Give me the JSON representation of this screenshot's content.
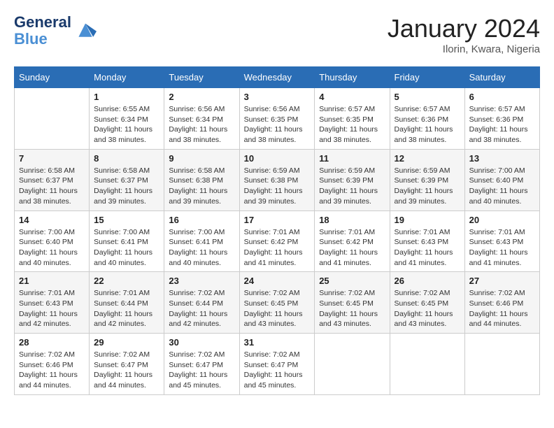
{
  "header": {
    "logo_line1": "General",
    "logo_line2": "Blue",
    "month_title": "January 2024",
    "location": "Ilorin, Kwara, Nigeria"
  },
  "days_of_week": [
    "Sunday",
    "Monday",
    "Tuesday",
    "Wednesday",
    "Thursday",
    "Friday",
    "Saturday"
  ],
  "weeks": [
    [
      {
        "day": "",
        "empty": true
      },
      {
        "day": "1",
        "sunrise": "6:55 AM",
        "sunset": "6:34 PM",
        "daylight": "11 hours and 38 minutes."
      },
      {
        "day": "2",
        "sunrise": "6:56 AM",
        "sunset": "6:34 PM",
        "daylight": "11 hours and 38 minutes."
      },
      {
        "day": "3",
        "sunrise": "6:56 AM",
        "sunset": "6:35 PM",
        "daylight": "11 hours and 38 minutes."
      },
      {
        "day": "4",
        "sunrise": "6:57 AM",
        "sunset": "6:35 PM",
        "daylight": "11 hours and 38 minutes."
      },
      {
        "day": "5",
        "sunrise": "6:57 AM",
        "sunset": "6:36 PM",
        "daylight": "11 hours and 38 minutes."
      },
      {
        "day": "6",
        "sunrise": "6:57 AM",
        "sunset": "6:36 PM",
        "daylight": "11 hours and 38 minutes."
      }
    ],
    [
      {
        "day": "7",
        "sunrise": "6:58 AM",
        "sunset": "6:37 PM",
        "daylight": "11 hours and 38 minutes."
      },
      {
        "day": "8",
        "sunrise": "6:58 AM",
        "sunset": "6:37 PM",
        "daylight": "11 hours and 39 minutes."
      },
      {
        "day": "9",
        "sunrise": "6:58 AM",
        "sunset": "6:38 PM",
        "daylight": "11 hours and 39 minutes."
      },
      {
        "day": "10",
        "sunrise": "6:59 AM",
        "sunset": "6:38 PM",
        "daylight": "11 hours and 39 minutes."
      },
      {
        "day": "11",
        "sunrise": "6:59 AM",
        "sunset": "6:39 PM",
        "daylight": "11 hours and 39 minutes."
      },
      {
        "day": "12",
        "sunrise": "6:59 AM",
        "sunset": "6:39 PM",
        "daylight": "11 hours and 39 minutes."
      },
      {
        "day": "13",
        "sunrise": "7:00 AM",
        "sunset": "6:40 PM",
        "daylight": "11 hours and 40 minutes."
      }
    ],
    [
      {
        "day": "14",
        "sunrise": "7:00 AM",
        "sunset": "6:40 PM",
        "daylight": "11 hours and 40 minutes."
      },
      {
        "day": "15",
        "sunrise": "7:00 AM",
        "sunset": "6:41 PM",
        "daylight": "11 hours and 40 minutes."
      },
      {
        "day": "16",
        "sunrise": "7:00 AM",
        "sunset": "6:41 PM",
        "daylight": "11 hours and 40 minutes."
      },
      {
        "day": "17",
        "sunrise": "7:01 AM",
        "sunset": "6:42 PM",
        "daylight": "11 hours and 41 minutes."
      },
      {
        "day": "18",
        "sunrise": "7:01 AM",
        "sunset": "6:42 PM",
        "daylight": "11 hours and 41 minutes."
      },
      {
        "day": "19",
        "sunrise": "7:01 AM",
        "sunset": "6:43 PM",
        "daylight": "11 hours and 41 minutes."
      },
      {
        "day": "20",
        "sunrise": "7:01 AM",
        "sunset": "6:43 PM",
        "daylight": "11 hours and 41 minutes."
      }
    ],
    [
      {
        "day": "21",
        "sunrise": "7:01 AM",
        "sunset": "6:43 PM",
        "daylight": "11 hours and 42 minutes."
      },
      {
        "day": "22",
        "sunrise": "7:01 AM",
        "sunset": "6:44 PM",
        "daylight": "11 hours and 42 minutes."
      },
      {
        "day": "23",
        "sunrise": "7:02 AM",
        "sunset": "6:44 PM",
        "daylight": "11 hours and 42 minutes."
      },
      {
        "day": "24",
        "sunrise": "7:02 AM",
        "sunset": "6:45 PM",
        "daylight": "11 hours and 43 minutes."
      },
      {
        "day": "25",
        "sunrise": "7:02 AM",
        "sunset": "6:45 PM",
        "daylight": "11 hours and 43 minutes."
      },
      {
        "day": "26",
        "sunrise": "7:02 AM",
        "sunset": "6:45 PM",
        "daylight": "11 hours and 43 minutes."
      },
      {
        "day": "27",
        "sunrise": "7:02 AM",
        "sunset": "6:46 PM",
        "daylight": "11 hours and 44 minutes."
      }
    ],
    [
      {
        "day": "28",
        "sunrise": "7:02 AM",
        "sunset": "6:46 PM",
        "daylight": "11 hours and 44 minutes."
      },
      {
        "day": "29",
        "sunrise": "7:02 AM",
        "sunset": "6:47 PM",
        "daylight": "11 hours and 44 minutes."
      },
      {
        "day": "30",
        "sunrise": "7:02 AM",
        "sunset": "6:47 PM",
        "daylight": "11 hours and 45 minutes."
      },
      {
        "day": "31",
        "sunrise": "7:02 AM",
        "sunset": "6:47 PM",
        "daylight": "11 hours and 45 minutes."
      },
      {
        "day": "",
        "empty": true
      },
      {
        "day": "",
        "empty": true
      },
      {
        "day": "",
        "empty": true
      }
    ]
  ],
  "labels": {
    "sunrise_prefix": "Sunrise: ",
    "sunset_prefix": "Sunset: ",
    "daylight_label": "Daylight: "
  }
}
